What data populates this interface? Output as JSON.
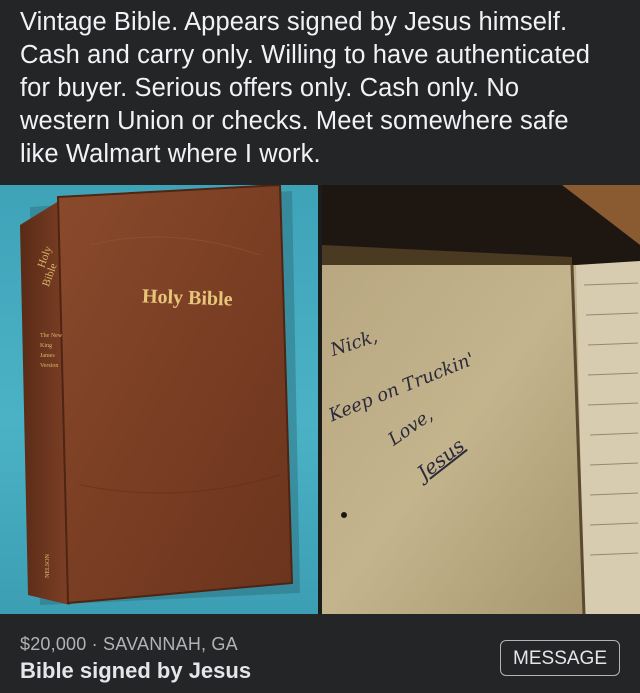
{
  "post": {
    "text": "Vintage Bible. Appears signed by Jesus himself.\nCash and carry only. Willing to have authenticated\nfor buyer. Serious offers only. Cash only. No\nwestern Union or checks. Meet somewhere safe\nlike Walmart where I work."
  },
  "photos": {
    "left": {
      "cover_title": "Holy Bible",
      "spine_title_1": "Holy",
      "spine_title_2": "Bible",
      "spine_sub_1": "The New",
      "spine_sub_2": "King",
      "spine_sub_3": "James",
      "spine_sub_4": "Version",
      "spine_publisher": "NELSON"
    },
    "right": {
      "inscription_1": "Nick,",
      "inscription_2": "Keep on Truckin'",
      "inscription_3": "Love,",
      "inscription_4": "Jesus"
    }
  },
  "listing": {
    "price_location": "$20,000 · SAVANNAH, GA",
    "title": "Bible signed by Jesus",
    "message_label": "MESSAGE"
  },
  "colors": {
    "background": "#242526",
    "text_primary": "#e4e6eb",
    "text_secondary": "#b0b3b8"
  }
}
